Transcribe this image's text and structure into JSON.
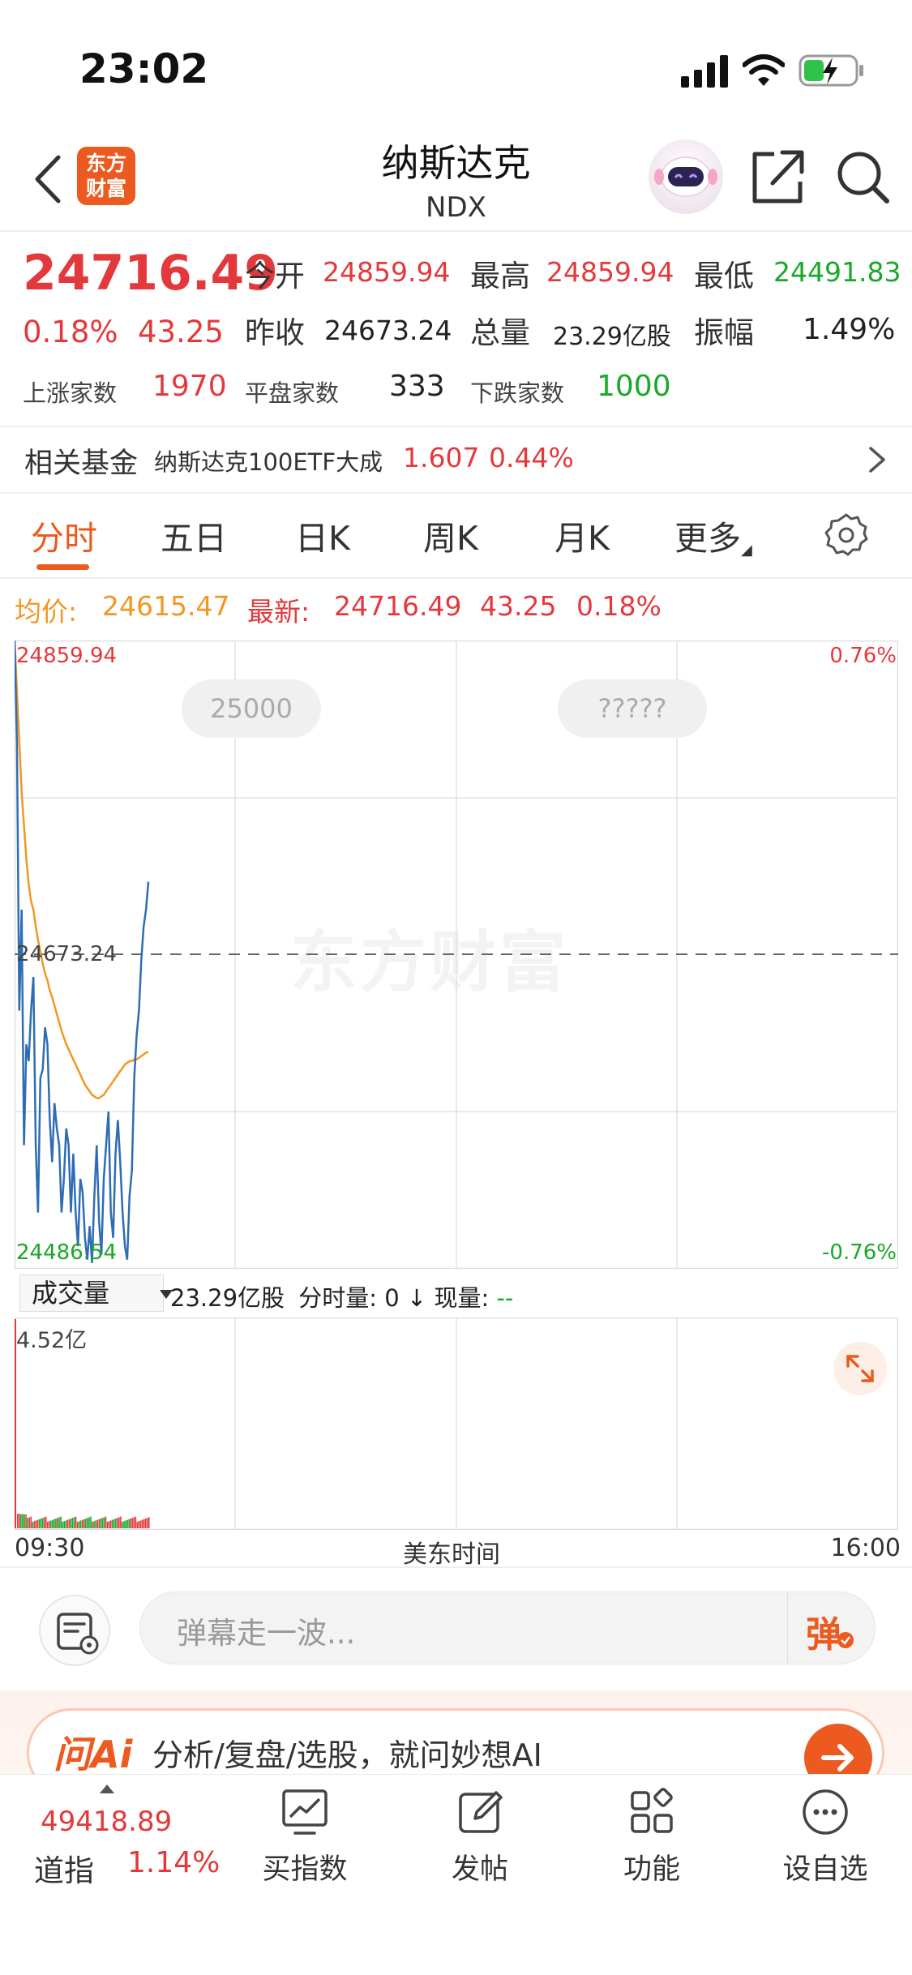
{
  "status_bar": {
    "time": "23:02"
  },
  "header": {
    "title": "纳斯达克",
    "subtitle": "NDX",
    "logo_text_1": "东方",
    "logo_text_2": "财富"
  },
  "quote": {
    "last_price": "24716.49",
    "change_pct": "0.18%",
    "change_amt": "43.25",
    "open_label": "今开",
    "open_value": "24859.94",
    "high_label": "最高",
    "high_value": "24859.94",
    "low_label": "最低",
    "low_value": "24491.83",
    "prev_close_label": "昨收",
    "prev_close_value": "24673.24",
    "volume_label": "总量",
    "volume_value": "23.29亿股",
    "amplitude_label": "振幅",
    "amplitude_value": "1.49%",
    "rise_label": "上涨家数",
    "rise_count": "1970",
    "flat_label": "平盘家数",
    "flat_count": "333",
    "fall_label": "下跌家数",
    "fall_count": "1000"
  },
  "related_fund": {
    "label": "相关基金",
    "name": "纳斯达克100ETF大成",
    "price": "1.607",
    "change_pct": "0.44%"
  },
  "tabs": [
    {
      "label": "分时"
    },
    {
      "label": "五日"
    },
    {
      "label": "日K"
    },
    {
      "label": "周K"
    },
    {
      "label": "月K"
    },
    {
      "label": "更多"
    }
  ],
  "info_line": {
    "avg_label": "均价:",
    "avg_value": "24615.47",
    "latest_label": "最新:",
    "latest_value": "24716.49",
    "latest_change": "43.25",
    "latest_pct": "0.18%"
  },
  "chart_labels": {
    "top_price": "24859.94",
    "mid_price": "24673.24",
    "bottom_price": "24486.54",
    "top_pct": "0.76%",
    "bottom_pct": "-0.76%",
    "bubble_1": "25000",
    "bubble_2": "?????",
    "watermark": "东方财富"
  },
  "volume": {
    "selector": "成交量",
    "total": "23.29亿股",
    "tick_label": "分时量:",
    "tick_value": "0",
    "now_label": "现量:",
    "now_value": "--",
    "max_label": "4.52亿"
  },
  "time_axis": {
    "start": "09:30",
    "middle": "美东时间",
    "end": "16:00"
  },
  "danmaku": {
    "placeholder": "弹幕走一波...",
    "send_label": "弹"
  },
  "ai_banner": {
    "logo": "问Ai",
    "text": "分析/复盘/选股，就问妙想AI"
  },
  "bottom_nav": {
    "dow_value": "49418.89",
    "dow_name": "道指",
    "dow_pct": "1.14%",
    "items": [
      {
        "label": "买指数"
      },
      {
        "label": "发帖"
      },
      {
        "label": "功能"
      },
      {
        "label": "设自选"
      }
    ]
  },
  "colors": {
    "up": "#e4393c",
    "down": "#1aa82a",
    "accent": "#ec5a1f",
    "price_line": "#2f6db3",
    "avg_line": "#f19722"
  },
  "chart_data": {
    "type": "line",
    "title": "",
    "ylim": [
      24486.54,
      24859.94
    ],
    "reference": 24673.24,
    "series": [
      {
        "name": "最新",
        "values": [
          24859.94,
          24800,
          24640,
          24700,
          24560,
          24620,
          24610,
          24640,
          24660,
          24560,
          24520,
          24600,
          24605,
          24630,
          24620,
          24575,
          24550,
          24585,
          24570,
          24560,
          24520,
          24540,
          24570,
          24560,
          24520,
          24555,
          24520,
          24500,
          24540,
          24532,
          24505,
          24492,
          24512,
          24490,
          24530,
          24560,
          24515,
          24495,
          24540,
          24560,
          24580,
          24520,
          24505,
          24555,
          24575,
          24550,
          24520,
          24500,
          24492,
          24530,
          24545,
          24600,
          24625,
          24640,
          24670,
          24690,
          24700,
          24716.49
        ]
      },
      {
        "name": "均价",
        "values": [
          24859.94,
          24830,
          24800,
          24770,
          24750,
          24730,
          24715,
          24705,
          24700,
          24690,
          24682,
          24675,
          24668,
          24662,
          24658,
          24652,
          24648,
          24643,
          24638,
          24633,
          24628,
          24624,
          24620,
          24617,
          24614,
          24611,
          24608,
          24605,
          24602,
          24599,
          24596,
          24594,
          24592,
          24590,
          24589,
          24588,
          24588,
          24589,
          24590,
          24592,
          24594,
          24596,
          24598,
          24600,
          24602,
          24604,
          24606,
          24608,
          24609,
          24610,
          24610,
          24611,
          24611,
          24612,
          24613,
          24614,
          24615,
          24615.47
        ]
      }
    ]
  }
}
